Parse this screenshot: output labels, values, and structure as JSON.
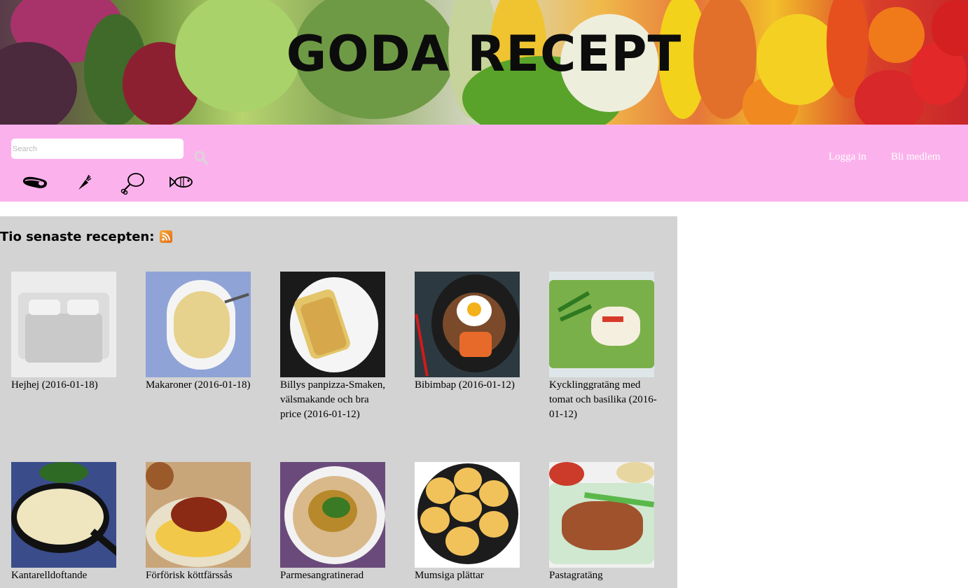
{
  "header": {
    "title": "GODA RECEPT"
  },
  "search": {
    "placeholder": "Search"
  },
  "categories": [
    "meat-icon",
    "carrot-icon",
    "chicken-leg-icon",
    "fish-icon"
  ],
  "auth": {
    "login_label": "Logga in",
    "signup_label": "Bli medlem"
  },
  "main": {
    "heading": "Tio senaste recepten:",
    "recipes": [
      {
        "title": "Hejhej (2016-01-18)"
      },
      {
        "title": "Makaroner (2016-01-18)"
      },
      {
        "title": "Billys panpizza-Smaken, välsmakande och bra price (2016-01-12)"
      },
      {
        "title": "Bibimbap (2016-01-12)"
      },
      {
        "title": "Kycklinggratäng med tomat och basilika (2016-01-12)"
      },
      {
        "title": "Kantarelldoftande"
      },
      {
        "title": "Förförisk köttfärssås"
      },
      {
        "title": "Parmesangratinerad"
      },
      {
        "title": "Mumsiga plättar"
      },
      {
        "title": "Pastagratäng"
      }
    ]
  },
  "colors": {
    "nav_bg": "#fbb2ec",
    "content_bg": "#d3d3d3"
  }
}
